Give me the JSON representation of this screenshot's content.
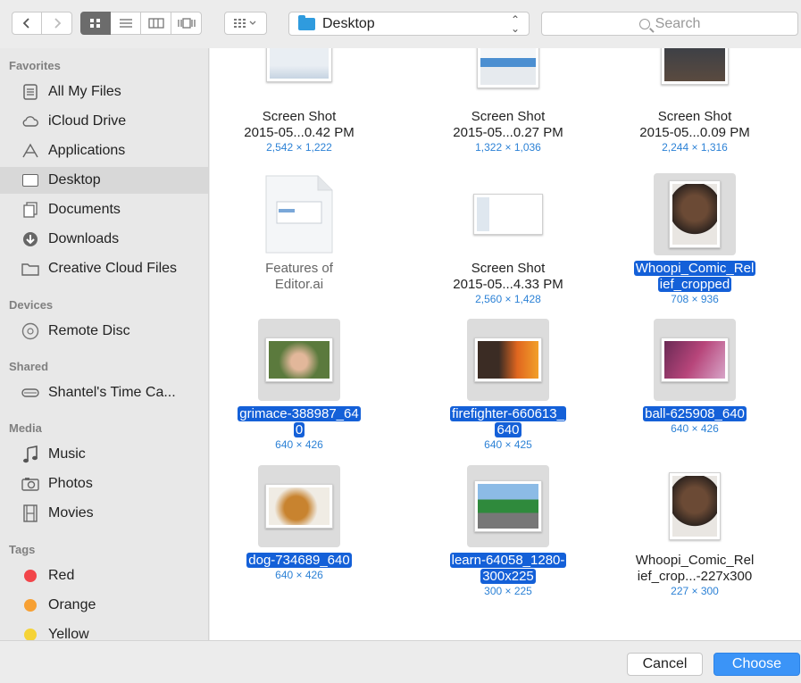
{
  "toolbar": {
    "location": "Desktop",
    "search_placeholder": "Search",
    "nav_back_icon": "chevron-left-icon",
    "nav_forward_icon": "chevron-right-icon",
    "view_modes": [
      "icon-view-icon",
      "list-view-icon",
      "column-view-icon",
      "coverflow-view-icon"
    ],
    "arrange_icon": "arrange-grid-icon"
  },
  "sidebar": {
    "favorites_heading": "Favorites",
    "favorites": [
      {
        "label": "All My Files",
        "icon": "all-files-icon"
      },
      {
        "label": "iCloud Drive",
        "icon": "cloud-icon"
      },
      {
        "label": "Applications",
        "icon": "applications-icon"
      },
      {
        "label": "Desktop",
        "icon": "desktop-icon"
      },
      {
        "label": "Documents",
        "icon": "documents-icon"
      },
      {
        "label": "Downloads",
        "icon": "downloads-icon"
      },
      {
        "label": "Creative Cloud Files",
        "icon": "folder-icon"
      }
    ],
    "devices_heading": "Devices",
    "devices": [
      {
        "label": "Remote Disc",
        "icon": "disc-icon"
      }
    ],
    "shared_heading": "Shared",
    "shared": [
      {
        "label": "Shantel's Time Ca...",
        "icon": "time-capsule-icon"
      }
    ],
    "media_heading": "Media",
    "media": [
      {
        "label": "Music",
        "icon": "music-icon"
      },
      {
        "label": "Photos",
        "icon": "camera-icon"
      },
      {
        "label": "Movies",
        "icon": "film-icon"
      }
    ],
    "tags_heading": "Tags",
    "tags": [
      {
        "label": "Red",
        "color": "#f2454a"
      },
      {
        "label": "Orange",
        "color": "#f7a033"
      },
      {
        "label": "Yellow",
        "color": "#f5d336"
      }
    ],
    "selected": "Desktop"
  },
  "files": [
    {
      "name_1": "Screen Shot",
      "name_2": "2015-05...0.42 PM",
      "dims": "2,542 × 1,222",
      "selected": false
    },
    {
      "name_1": "Screen Shot",
      "name_2": "2015-05...0.27 PM",
      "dims": "1,322 × 1,036",
      "selected": false
    },
    {
      "name_1": "Screen Shot",
      "name_2": "2015-05...0.09 PM",
      "dims": "2,244 × 1,316",
      "selected": false
    },
    {
      "name_1": "Features of",
      "name_2": "Editor.ai",
      "dims": "",
      "selected": false
    },
    {
      "name_1": "Screen Shot",
      "name_2": "2015-05...4.33 PM",
      "dims": "2,560 × 1,428",
      "selected": false
    },
    {
      "name_1": "Whoopi_Comic_Rel",
      "name_2": "ief_cropped",
      "dims": "708 × 936",
      "selected": true
    },
    {
      "name_1": "grimace-388987_64",
      "name_2": "0",
      "dims": "640 × 426",
      "selected": true
    },
    {
      "name_1": "firefighter-660613_",
      "name_2": "640",
      "dims": "640 × 425",
      "selected": true
    },
    {
      "name_1": "ball-625908_640",
      "name_2": "",
      "dims": "640 × 426",
      "selected": true
    },
    {
      "name_1": "dog-734689_640",
      "name_2": "",
      "dims": "640 × 426",
      "selected": true
    },
    {
      "name_1": "learn-64058_1280-",
      "name_2": "300x225",
      "dims": "300 × 225",
      "selected": true
    },
    {
      "name_1": "Whoopi_Comic_Rel",
      "name_2": "ief_crop...-227x300",
      "dims": "227 × 300",
      "selected": false
    }
  ],
  "footer": {
    "cancel_label": "Cancel",
    "choose_label": "Choose"
  },
  "colors": {
    "accent": "#3b94f7",
    "selection": "#1460d8",
    "dims_text": "#2d82d6"
  }
}
